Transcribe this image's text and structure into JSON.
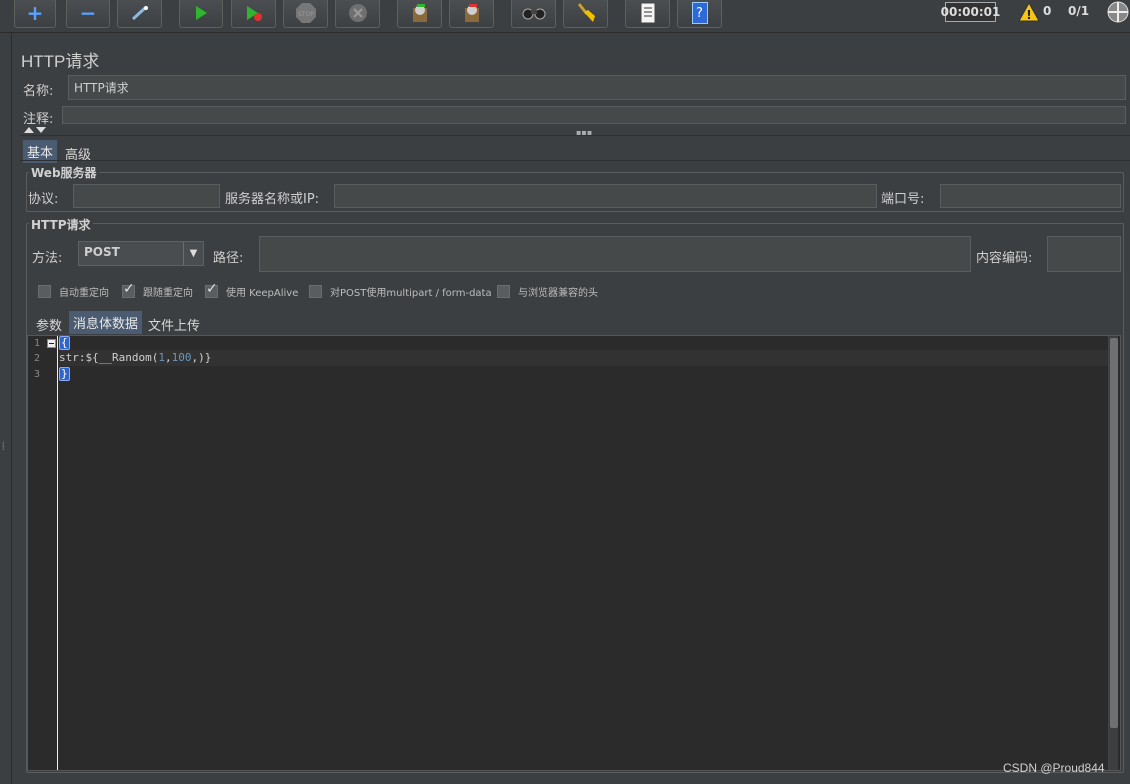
{
  "toolbar": {
    "buttons": [
      {
        "name": "add",
        "label": "+"
      },
      {
        "name": "remove",
        "label": "−"
      },
      {
        "name": "toggle",
        "label": ""
      },
      {
        "name": "start",
        "label": ""
      },
      {
        "name": "start-no-pause",
        "label": ""
      },
      {
        "name": "stop",
        "label": "STOP"
      },
      {
        "name": "shutdown",
        "label": ""
      },
      {
        "name": "remote-start",
        "label": ""
      },
      {
        "name": "remote-stop",
        "label": ""
      },
      {
        "name": "search",
        "label": ""
      },
      {
        "name": "clear",
        "label": ""
      },
      {
        "name": "function-helper",
        "label": ""
      },
      {
        "name": "help",
        "label": "?"
      }
    ],
    "timer": "00:00:01",
    "warning_count": "0",
    "threads": "0/1"
  },
  "panel": {
    "title": "HTTP请求",
    "name_label": "名称:",
    "name_value": "HTTP请求",
    "comment_label": "注释:",
    "comment_value": ""
  },
  "tabs": {
    "basic": "基本",
    "advanced": "高级"
  },
  "web_server": {
    "group_title": "Web服务器",
    "protocol_label": "协议:",
    "protocol_value": "",
    "server_label": "服务器名称或IP:",
    "server_value": "",
    "port_label": "端口号:",
    "port_value": ""
  },
  "http_request": {
    "group_title": "HTTP请求",
    "method_label": "方法:",
    "method_value": "POST",
    "path_label": "路径:",
    "path_value": "",
    "encoding_label": "内容编码:",
    "encoding_value": ""
  },
  "options": [
    {
      "label": "自动重定向",
      "checked": false
    },
    {
      "label": "跟随重定向",
      "checked": true
    },
    {
      "label": "使用 KeepAlive",
      "checked": true
    },
    {
      "label": "对POST使用multipart / form-data",
      "checked": false
    },
    {
      "label": "与浏览器兼容的头",
      "checked": false
    }
  ],
  "body_tabs": {
    "params": "参数",
    "body_data": "消息体数据",
    "file_upload": "文件上传"
  },
  "editor": {
    "line_numbers": [
      "1",
      "2",
      "3"
    ],
    "open_brace": "{",
    "line2_prefix": "str:${__Random(",
    "line2_num1": "1",
    "line2_comma": ",",
    "line2_num2": "100",
    "line2_suffix": ",)}",
    "close_brace": "}"
  },
  "watermark": "CSDN @Proud844"
}
